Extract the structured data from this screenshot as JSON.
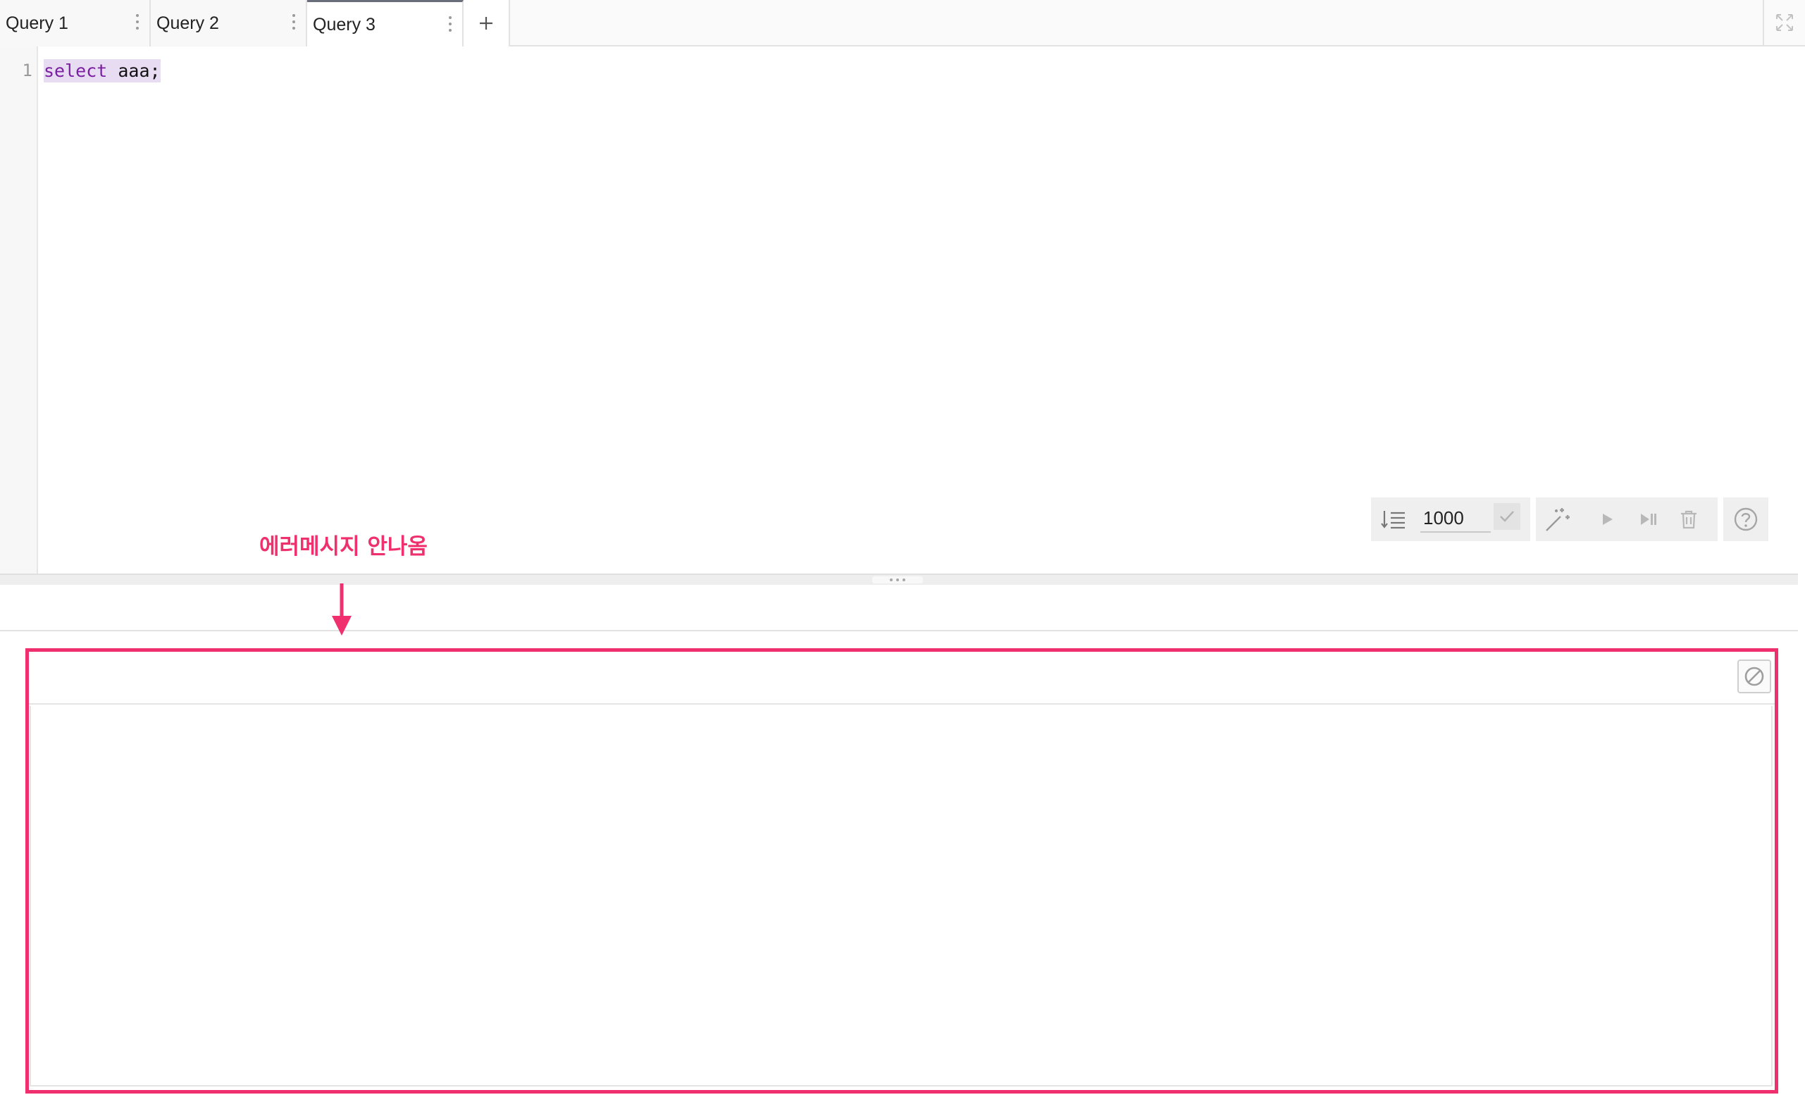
{
  "tabs": [
    {
      "label": "Query 1",
      "active": false
    },
    {
      "label": "Query 2",
      "active": false
    },
    {
      "label": "Query 3",
      "active": true
    }
  ],
  "editor": {
    "line_number": "1",
    "keyword": "select",
    "identifier": " aaa;"
  },
  "toolbar": {
    "row_limit_value": "1000",
    "icons": [
      "row-limit-icon",
      "check-icon",
      "magic-wand-icon",
      "play-icon",
      "step-forward-icon",
      "trash-icon",
      "help-icon"
    ]
  },
  "annotation": {
    "text": "에러메시지 안나옴",
    "color": "#f0306e"
  },
  "colors": {
    "accent": "#f0306e",
    "keyword": "#7a1fa2",
    "selection": "#e8dcf3"
  }
}
